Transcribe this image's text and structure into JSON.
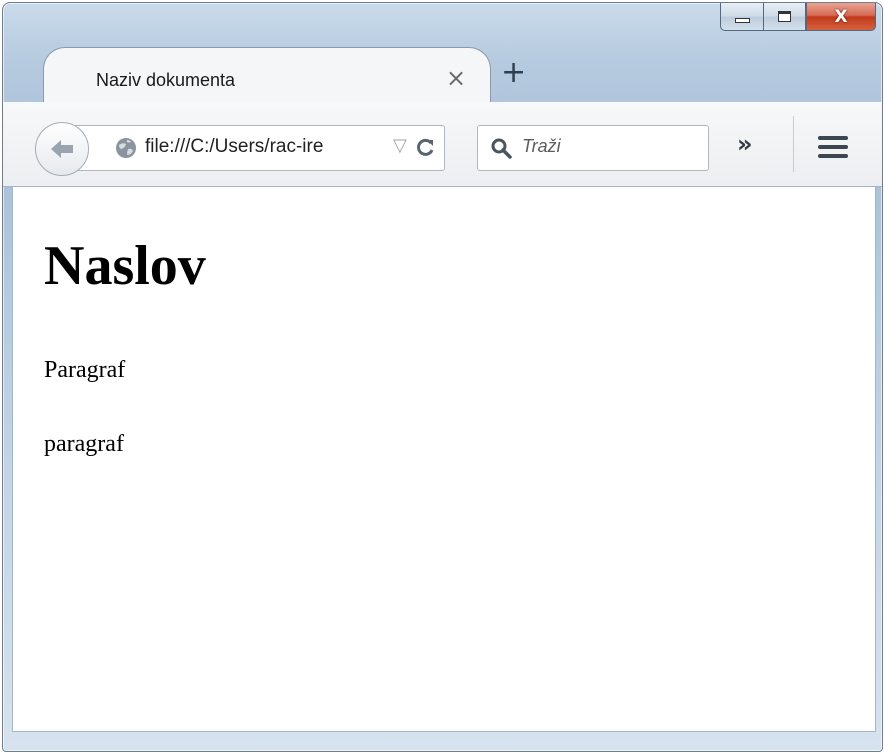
{
  "window": {
    "minimize_icon": "minimize-icon",
    "maximize_icon": "maximize-icon",
    "close_label": "X"
  },
  "tab": {
    "title": "Naziv dokumenta",
    "close_glyph": "×",
    "new_tab_glyph": "+"
  },
  "toolbar": {
    "url": "file:///C:/Users/rac-ire",
    "dropmarker": "▽",
    "reload_glyph": "C",
    "search_placeholder": "Traži",
    "overflow_glyph": "»"
  },
  "page": {
    "heading": "Naslov",
    "paragraphs": [
      "Paragraf",
      "paragraf"
    ]
  },
  "colors": {
    "close_button": "#c2391b",
    "frame": "#b6cadf"
  }
}
